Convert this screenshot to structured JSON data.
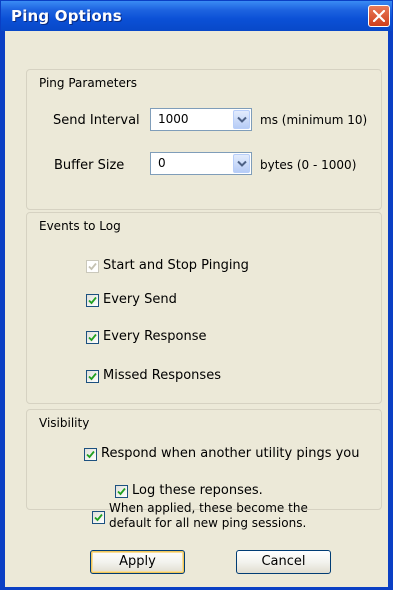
{
  "window": {
    "title": "Ping Options",
    "close_icon": "close-x-icon"
  },
  "ping_parameters": {
    "title": "Ping Parameters",
    "send_interval_label": "Send Interval",
    "send_interval_value": "1000",
    "send_interval_hint": "ms (minimum 10)",
    "buffer_size_label": "Buffer Size",
    "buffer_size_value": "0",
    "buffer_size_hint": "bytes (0 - 1000)"
  },
  "events_to_log": {
    "title": "Events to Log",
    "items": [
      {
        "label": "Start and Stop Pinging",
        "checked": true,
        "disabled": true
      },
      {
        "label": "Every Send",
        "checked": true,
        "disabled": false
      },
      {
        "label": "Every Response",
        "checked": true,
        "disabled": false
      },
      {
        "label": "Missed Responses",
        "checked": true,
        "disabled": false
      }
    ]
  },
  "visibility": {
    "title": "Visibility",
    "respond_label": "Respond when another utility pings you",
    "respond_checked": true,
    "log_label": "Log these reponses.",
    "log_checked": true
  },
  "defaults": {
    "line1": "When applied, these become the",
    "line2": "default for all new ping sessions.",
    "checked": true
  },
  "buttons": {
    "apply": "Apply",
    "cancel": "Cancel"
  },
  "colors": {
    "titlebar": "#0b50d6",
    "dialog_bg": "#ece9d8",
    "check_mark": "#21a121",
    "close_button": "#cf3e1b"
  }
}
